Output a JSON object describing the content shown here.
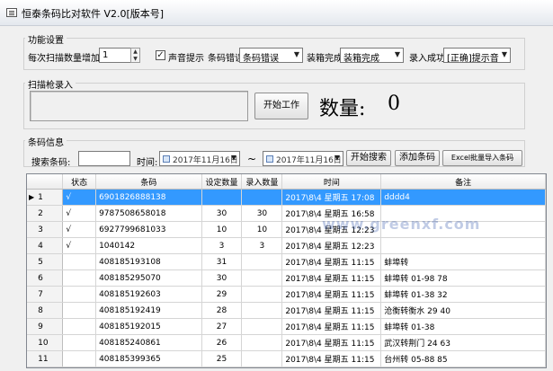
{
  "window": {
    "title": "恒泰条码比对软件 V2.0[版本号]"
  },
  "settings": {
    "group_label": "功能设置",
    "increment_label": "每次扫描数量增加:",
    "increment_value": "1",
    "sound_checkbox_label": "声音提示",
    "sound_checked": true,
    "barcode_error_label": "条码错误",
    "barcode_error_value": "条码错误",
    "box_done_label": "装箱完成",
    "box_done_value": "装箱完成",
    "entry_success_label": "录入成功",
    "entry_success_value": "[正确]提示音"
  },
  "scanner": {
    "group_label": "扫描枪录入",
    "start_button": "开始工作",
    "count_label": "数量:",
    "count_value": "0"
  },
  "barcode_info": {
    "group_label": "条码信息",
    "search_label": "搜索条码:",
    "search_value": "",
    "time_label": "时间:",
    "date_from": "2017年11月16日",
    "tilde": "~",
    "date_to": "2017年11月16日",
    "search_button": "开始搜索",
    "add_button": "添加条码",
    "import_button": "Excel批量导入条码"
  },
  "table": {
    "columns": [
      "状态",
      "条码",
      "设定数量",
      "录入数量",
      "时间",
      "备注"
    ],
    "rows": [
      {
        "no": "1",
        "status": "√",
        "barcode": "6901826888138",
        "set": "",
        "entered": "",
        "time": "2017\\8\\4 星期五 17:08",
        "note": "dddd4",
        "selected": true
      },
      {
        "no": "2",
        "status": "√",
        "barcode": "9787508658018",
        "set": "30",
        "entered": "30",
        "time": "2017\\8\\4 星期五 16:58",
        "note": ""
      },
      {
        "no": "3",
        "status": "√",
        "barcode": "6927799681033",
        "set": "10",
        "entered": "10",
        "time": "2017\\8\\4 星期五 12:23",
        "note": ""
      },
      {
        "no": "4",
        "status": "√",
        "barcode": "1040142",
        "set": "3",
        "entered": "3",
        "time": "2017\\8\\4 星期五 12:23",
        "note": ""
      },
      {
        "no": "5",
        "status": "",
        "barcode": "408185193108",
        "set": "31",
        "entered": "",
        "time": "2017\\8\\4 星期五 11:15",
        "note": "蚌埠转"
      },
      {
        "no": "6",
        "status": "",
        "barcode": "408185295070",
        "set": "30",
        "entered": "",
        "time": "2017\\8\\4 星期五 11:15",
        "note": "蚌埠转 01-98 78"
      },
      {
        "no": "7",
        "status": "",
        "barcode": "408185192603",
        "set": "29",
        "entered": "",
        "time": "2017\\8\\4 星期五 11:15",
        "note": "蚌埠转 01-38 32"
      },
      {
        "no": "8",
        "status": "",
        "barcode": "408185192419",
        "set": "28",
        "entered": "",
        "time": "2017\\8\\4 星期五 11:15",
        "note": "沧衡转衡水 29 40"
      },
      {
        "no": "9",
        "status": "",
        "barcode": "408185192015",
        "set": "27",
        "entered": "",
        "time": "2017\\8\\4 星期五 11:15",
        "note": "蚌埠转 01-38"
      },
      {
        "no": "10",
        "status": "",
        "barcode": "408185240861",
        "set": "26",
        "entered": "",
        "time": "2017\\8\\4 星期五 11:15",
        "note": "武汉转荆门 24 63"
      },
      {
        "no": "11",
        "status": "",
        "barcode": "408185399365",
        "set": "25",
        "entered": "",
        "time": "2017\\8\\4 星期五 11:15",
        "note": "台州转 05-88 85"
      }
    ]
  },
  "watermark": "www.greenxf.com"
}
